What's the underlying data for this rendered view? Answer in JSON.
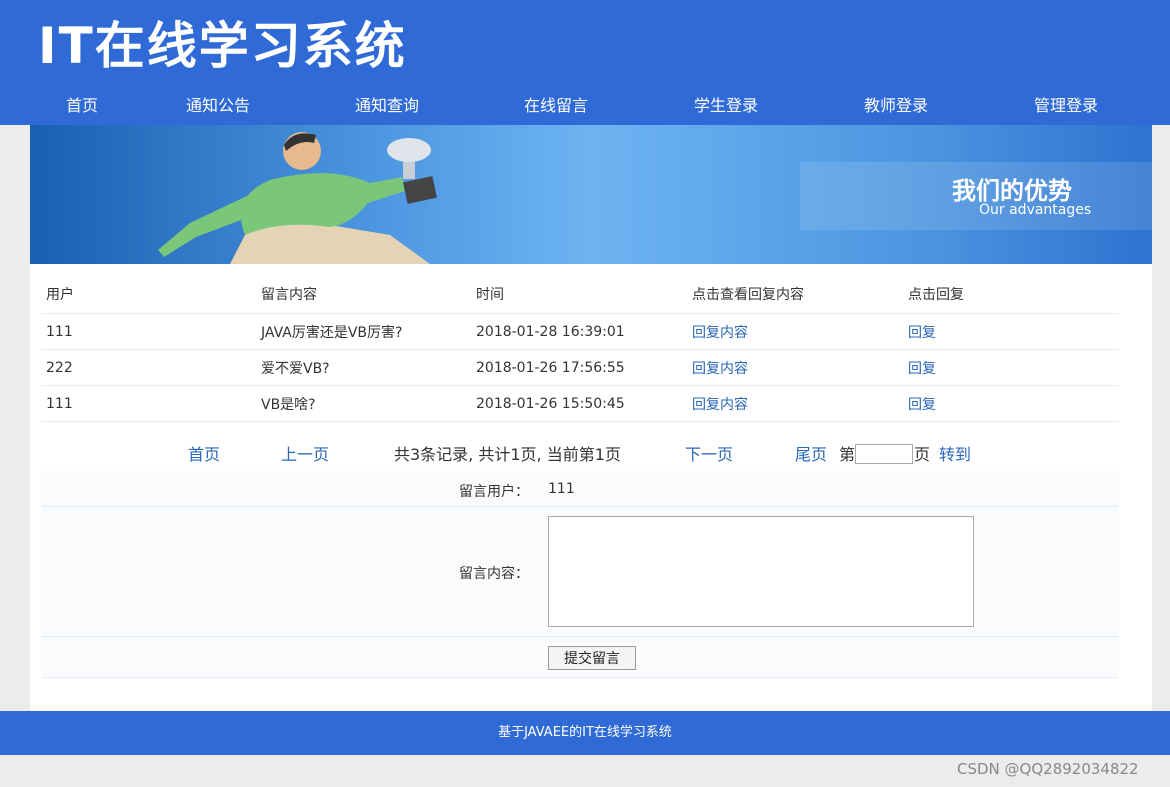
{
  "header": {
    "title": "IT在线学习系统"
  },
  "nav": [
    "首页",
    "通知公告",
    "通知查询",
    "在线留言",
    "学生登录",
    "教师登录",
    "管理登录"
  ],
  "banner": {
    "cn": "我们的优势",
    "en": "Our advantages"
  },
  "table": {
    "headers": [
      "用户",
      "留言内容",
      "时间",
      "点击查看回复内容",
      "点击回复"
    ],
    "rows": [
      {
        "user": "111",
        "content": "JAVA厉害还是VB厉害?",
        "time": "2018-01-28 16:39:01",
        "view": "回复内容",
        "reply": "回复"
      },
      {
        "user": "222",
        "content": "爱不爱VB?",
        "time": "2018-01-26 17:56:55",
        "view": "回复内容",
        "reply": "回复"
      },
      {
        "user": "111",
        "content": "VB是啥?",
        "time": "2018-01-26 15:50:45",
        "view": "回复内容",
        "reply": "回复"
      }
    ]
  },
  "pager": {
    "first": "首页",
    "prev": "上一页",
    "summary": "共3条记录, 共计1页, 当前第1页",
    "next": "下一页",
    "last": "尾页",
    "page_prefix": "第",
    "page_input": "",
    "page_suffix": "页",
    "go": "转到"
  },
  "form": {
    "user_label": "留言用户：",
    "user_value": "111",
    "content_label": "留言内容：",
    "content_value": "",
    "submit_label": "提交留言"
  },
  "footer": {
    "text": "基于JAVAEE的IT在线学习系统"
  },
  "watermark": "CSDN @QQ2892034822",
  "colors": {
    "brand_blue": "#2f6ad6",
    "link_blue": "#2a66b8",
    "page_bg": "#ececec"
  }
}
